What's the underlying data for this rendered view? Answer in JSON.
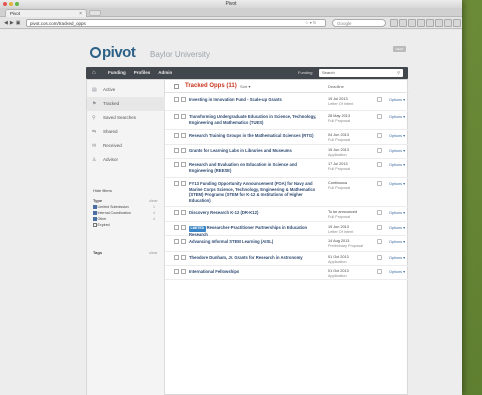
{
  "window": {
    "title": "Pivot",
    "tab_label": "Pivot",
    "url": "pivot.cos.com/tracked_opps",
    "search_engine_placeholder": "Google"
  },
  "header": {
    "logo": "pivot",
    "org": "Baylor University",
    "badge": "HELP"
  },
  "nav": {
    "links": [
      "Funding",
      "Profiles",
      "Admin"
    ],
    "search_label": "Funding",
    "search_placeholder": "Search"
  },
  "sidebar": {
    "items": [
      {
        "label": "Active",
        "icon": "document-icon",
        "count": ""
      },
      {
        "label": "Tracked",
        "icon": "flag-icon",
        "count": ""
      },
      {
        "label": "Saved Searches",
        "icon": "search-icon",
        "count": ""
      },
      {
        "label": "Shared",
        "icon": "share-icon",
        "count": ""
      },
      {
        "label": "Received",
        "icon": "inbox-icon",
        "count": ""
      },
      {
        "label": "Advisor",
        "icon": "person-icon",
        "count": ""
      }
    ],
    "hide_filters": "Hide filters",
    "type_label": "Type",
    "type_more": "clear",
    "facets": [
      {
        "label": "Limited Submission",
        "checked": true,
        "n": "1"
      },
      {
        "label": "Internal Coordination",
        "checked": true,
        "n": "4"
      },
      {
        "label": "Other",
        "checked": true,
        "n": "4"
      },
      {
        "label": "Expired",
        "checked": false,
        "n": ""
      }
    ],
    "tags_label": "Tags",
    "tags_more": "clear"
  },
  "main": {
    "title": "Tracked Opps (11)",
    "sort": "Sort ▾",
    "deadline_header": "Deadline",
    "options_label": "Options ▾",
    "rows": [
      {
        "title": "Investing in Innovation Fund - Scale-up Grants",
        "badge": "",
        "date": "19 Jul 2013",
        "sub": "Letter Of Intent"
      },
      {
        "title": "Transforming Undergraduate Education in Science, Technology, Engineering and Mathematics (TUES)",
        "badge": "",
        "date": "28 May 2013",
        "sub": "Full Proposal"
      },
      {
        "title": "Research Training Groups in the Mathematical Sciences (RTG)",
        "badge": "",
        "date": "04 Jun 2013",
        "sub": "Full Proposal"
      },
      {
        "title": "Grants for Learning Labs in Libraries and Museums",
        "badge": "",
        "date": "15 Jun 2013",
        "sub": "Application"
      },
      {
        "title": "Research and Evaluation on Education in Science and Engineering (REESE)",
        "badge": "",
        "date": "17 Jul 2013",
        "sub": "Full Proposal"
      },
      {
        "title": "FY13 Funding Opportunity Announcement (FOA) for Navy and Marine Corps Science, Technology, Engineering & Mathematics (STEM) Programs (STEM for K-12 & Institutions of Higher Education)",
        "badge": "",
        "date": "Continuous",
        "sub": "Full Proposal"
      },
      {
        "title": "Discovery Research K-12 (DR-K12)",
        "badge": "",
        "date": "To be announced",
        "sub": "Full Proposal"
      },
      {
        "title": "Researcher-Practitioner Partnerships in Education Research",
        "badge": "LIMITED",
        "date": "19 Jun 2013",
        "sub": "Letter Of Intent"
      },
      {
        "title": "Advancing Informal STEM Learning (AISL)",
        "badge": "",
        "date": "14 Aug 2013",
        "sub": "Preliminary Proposal"
      },
      {
        "title": "Theodore Dunham, Jr. Grants for Research in Astronomy",
        "badge": "",
        "date": "01 Oct 2013",
        "sub": "Application"
      },
      {
        "title": "International Fellowships",
        "badge": "",
        "date": "01 Oct 2013",
        "sub": "Application"
      }
    ]
  }
}
